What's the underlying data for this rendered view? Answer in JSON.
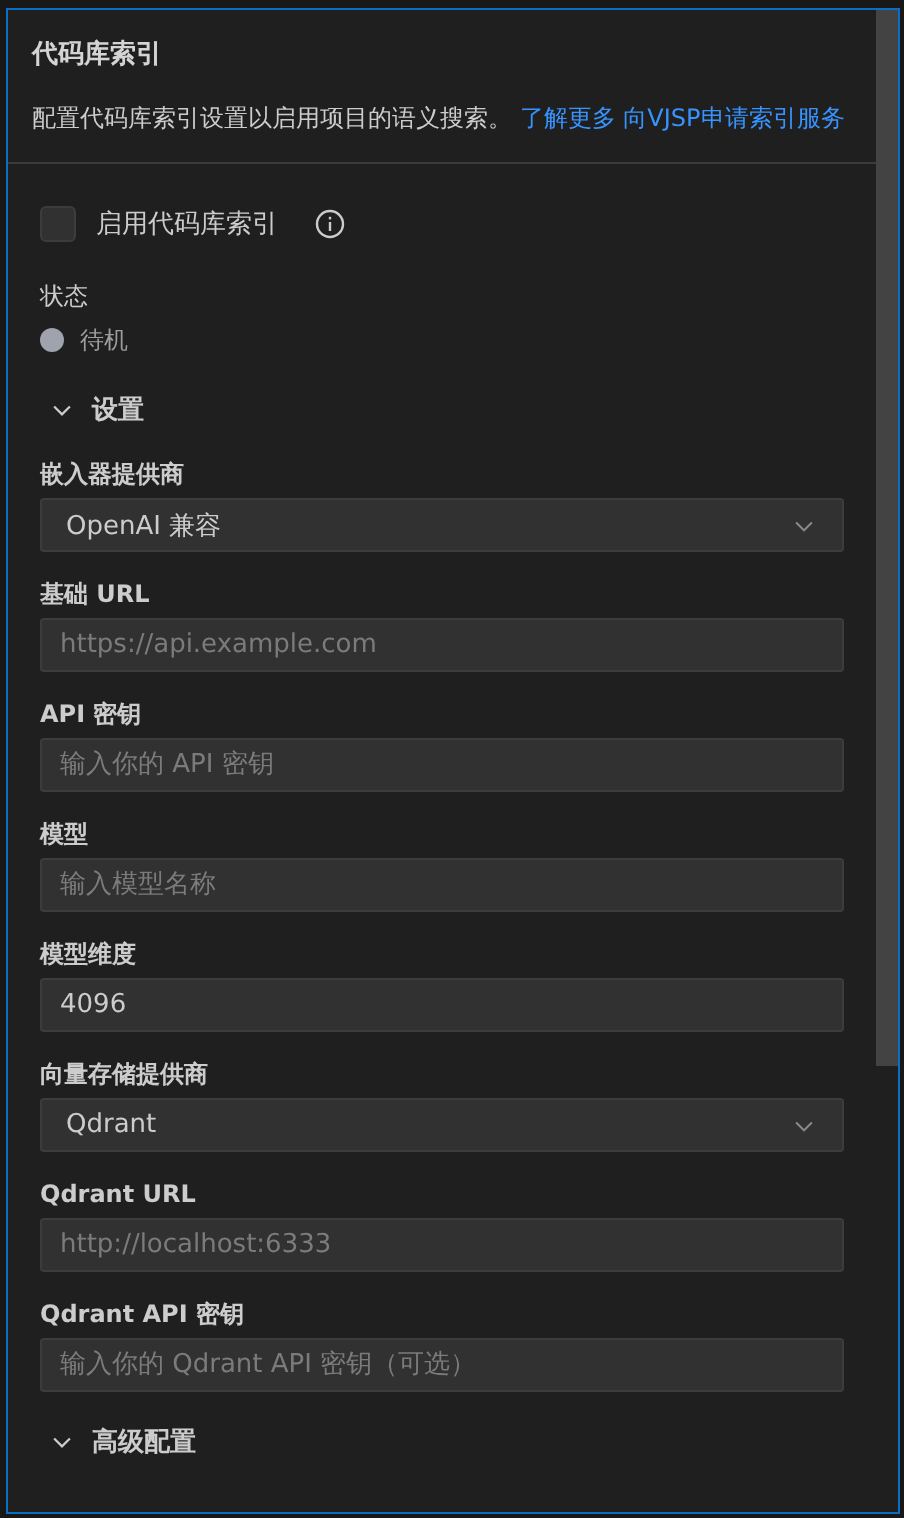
{
  "header": {
    "title": "代码库索引",
    "description": "配置代码库索引设置以启用项目的语义搜索。",
    "links": [
      "了解更多",
      "向VJSP申请索引服务"
    ]
  },
  "enable": {
    "label": "启用代码库索引",
    "checked": false
  },
  "status": {
    "label": "状态",
    "value": "待机",
    "color": "#9ea3ad"
  },
  "sections": [
    {
      "title": "设置",
      "expanded": true,
      "fields": [
        {
          "kind": "select",
          "label": "嵌入器提供商",
          "value": "OpenAI 兼容"
        },
        {
          "kind": "input",
          "label": "基础 URL",
          "placeholder": "https://api.example.com"
        },
        {
          "kind": "input",
          "label": "API 密钥",
          "placeholder": "输入你的 API 密钥"
        },
        {
          "kind": "input",
          "label": "模型",
          "placeholder": "输入模型名称"
        },
        {
          "kind": "input",
          "label": "模型维度",
          "value": "4096"
        },
        {
          "kind": "select",
          "label": "向量存储提供商",
          "value": "Qdrant"
        },
        {
          "kind": "input",
          "label": "Qdrant URL",
          "placeholder": "http://localhost:6333"
        },
        {
          "kind": "input",
          "label": "Qdrant API 密钥",
          "placeholder": "输入你的 Qdrant API 密钥（可选）"
        }
      ]
    },
    {
      "title": "高级配置",
      "expanded": true
    }
  ]
}
